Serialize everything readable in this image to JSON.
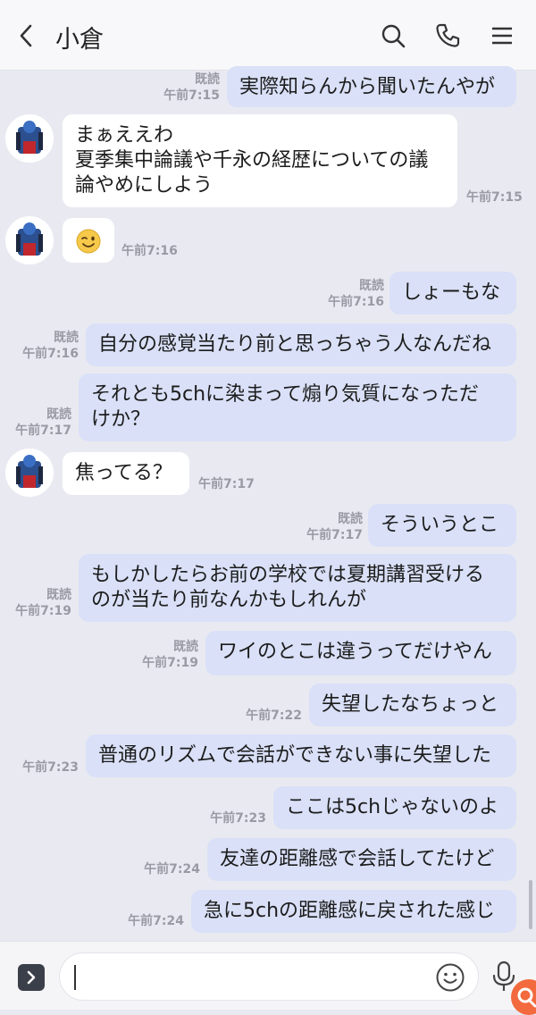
{
  "header": {
    "title": "小倉",
    "icons": [
      "back-icon",
      "search-icon",
      "phone-icon",
      "menu-icon"
    ]
  },
  "messages": [
    {
      "dir": "sent",
      "lines": [
        "実際知らんから聞いたんやが"
      ],
      "read": "既読",
      "time": "午前7:15"
    },
    {
      "dir": "recv",
      "lines": [
        "まぁええわ",
        "夏季集中論議や千永の経歴についての議",
        "論やめにしよう"
      ],
      "time": "午前7:15"
    },
    {
      "dir": "recv",
      "emoji": "wink-emoji",
      "time": "午前7:16"
    },
    {
      "dir": "sent",
      "lines": [
        "しょーもな"
      ],
      "read": "既読",
      "time": "午前7:16"
    },
    {
      "dir": "sent",
      "lines": [
        "自分の感覚当たり前と思っちゃう人なんだね"
      ],
      "read": "既読",
      "time": "午前7:16"
    },
    {
      "dir": "sent",
      "lines": [
        "それとも5chに染まって煽り気質になっただ",
        "けか？"
      ],
      "read": "既読",
      "time": "午前7:17"
    },
    {
      "dir": "recv",
      "lines": [
        "焦ってる？"
      ],
      "time": "午前7:17"
    },
    {
      "dir": "sent",
      "lines": [
        "そういうとこ"
      ],
      "read": "既読",
      "time": "午前7:17"
    },
    {
      "dir": "sent",
      "lines": [
        "もしかしたらお前の学校では夏期講習受ける",
        "のが当たり前なんかもしれんが"
      ],
      "read": "既読",
      "time": "午前7:19"
    },
    {
      "dir": "sent",
      "lines": [
        "ワイのとこは違うってだけやん"
      ],
      "read": "既読",
      "time": "午前7:19"
    },
    {
      "dir": "sent",
      "lines": [
        "失望したなちょっと"
      ],
      "time": "午前7:22"
    },
    {
      "dir": "sent",
      "lines": [
        "普通のリズムで会話ができない事に失望した"
      ],
      "time": "午前7:23"
    },
    {
      "dir": "sent",
      "lines": [
        "ここは5chじゃないのよ"
      ],
      "time": "午前7:23"
    },
    {
      "dir": "sent",
      "lines": [
        "友達の距離感で会話してたけど"
      ],
      "time": "午前7:24"
    },
    {
      "dir": "sent",
      "lines": [
        "急に5chの距離感に戻された感じ"
      ],
      "time": "午前7:24"
    }
  ],
  "input": {
    "value": ""
  },
  "colors": {
    "sent_bubble": "#d9e0f7",
    "recv_bubble": "#ffffff",
    "background": "#e9eaf1",
    "badge": "#f26a3d"
  }
}
